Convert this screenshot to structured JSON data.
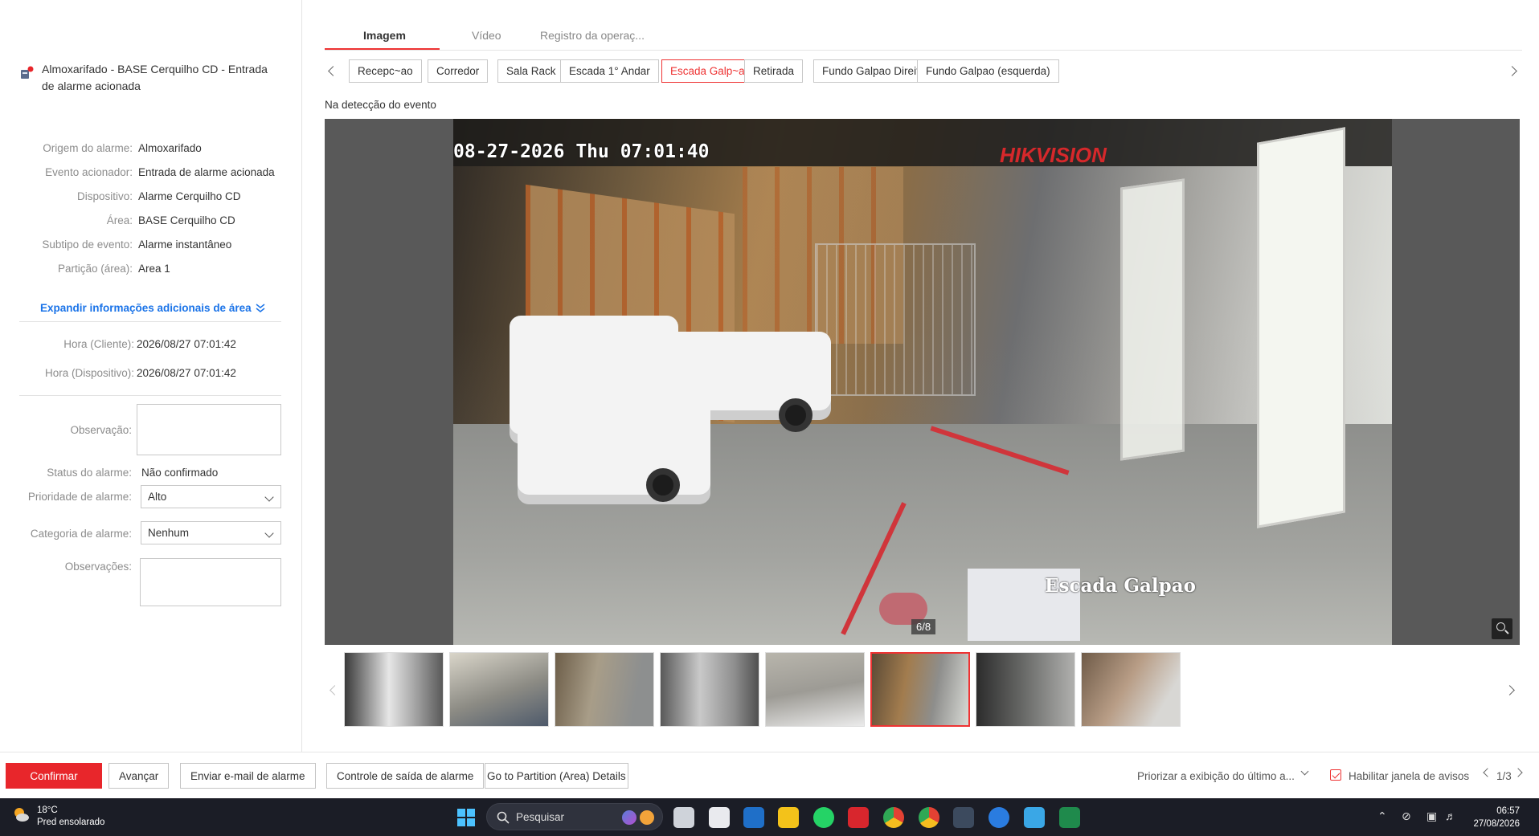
{
  "alarm": {
    "title": "Almoxarifado - BASE Cerquilho CD - Entrada de alarme acionada"
  },
  "info": [
    {
      "label": "Origem do alarme:",
      "value": "Almoxarifado"
    },
    {
      "label": "Evento acionador:",
      "value": "Entrada de alarme acionada"
    },
    {
      "label": "Dispositivo:",
      "value": "Alarme Cerquilho CD"
    },
    {
      "label": "Área:",
      "value": "BASE Cerquilho CD"
    },
    {
      "label": "Subtipo de evento:",
      "value": "Alarme instantâneo"
    },
    {
      "label": "Partição (área):",
      "value": "Area 1"
    }
  ],
  "expand_link": "Expandir informações adicionais de área",
  "times": [
    {
      "label": "Hora (Cliente):",
      "value": "2026/08/27 07:01:42"
    },
    {
      "label": "Hora (Dispositivo):",
      "value": "2026/08/27 07:01:42"
    }
  ],
  "form": {
    "observacao_label": "Observação:",
    "status_label": "Status do alarme:",
    "status_value": "Não confirmado",
    "priority_label": "Prioridade de alarme:",
    "priority_value": "Alto",
    "category_label": "Categoria de alarme:",
    "category_value": "Nenhum",
    "observacoes_label": "Observações:"
  },
  "tabs": [
    "Imagem",
    "Vídeo",
    "Registro da operaç..."
  ],
  "active_tab": "Imagem",
  "cameras": [
    "Recepc~ao",
    "Corredor",
    "Sala Rack",
    "Escada 1° Andar",
    "Escada Galp~ao",
    "Retirada",
    "Fundo Galpao Direita",
    "Fundo Galpao (esquerda)"
  ],
  "active_camera": "Escada Galp~ao",
  "event_caption": "Na detecção do evento",
  "viewer": {
    "osd_time": "08-27-2026 Thu 07:01:40",
    "osd_brand": "HIKVISION",
    "osd_camera": "Escada Galpao",
    "page_counter": "6/8"
  },
  "thumbnails_count": 8,
  "active_thumbnail": 6,
  "bottom": {
    "confirm": "Confirmar",
    "next": "Avançar",
    "email": "Enviar e-mail de alarme",
    "output": "Controle de saída de alarme",
    "partition": "Go to Partition (Area) Details",
    "prioritize": "Priorizar a exibição do último a...",
    "enable_popup": "Habilitar janela de avisos",
    "pager": "1/3"
  },
  "taskbar": {
    "temperature": "18°C",
    "weather": "Pred ensolarado",
    "search": "Pesquisar",
    "time": "06:57",
    "date": "27/08/2026"
  },
  "colors": {
    "accent": "#e8262b",
    "link": "#1a73e8"
  }
}
